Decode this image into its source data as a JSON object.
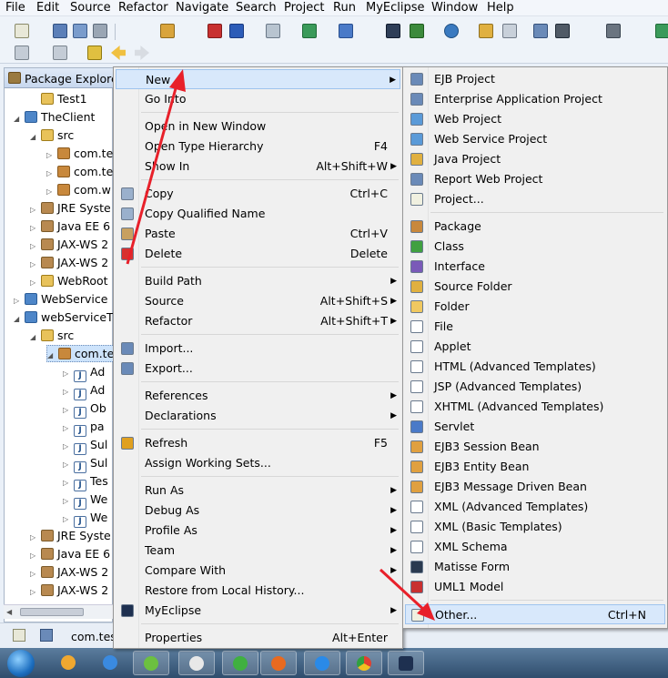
{
  "menubar": {
    "items": [
      "File",
      "Edit",
      "Source",
      "Refactor",
      "Navigate",
      "Search",
      "Project",
      "Run",
      "MyEclipse",
      "Window",
      "Help"
    ]
  },
  "explorer": {
    "title": "Package Explore",
    "tree": [
      {
        "label": "Test1",
        "icon": "folder-icon"
      },
      {
        "label": "TheClient",
        "icon": "project-icon"
      },
      {
        "label": "src",
        "icon": "source-folder-icon"
      },
      {
        "label": "com.te",
        "icon": "package-icon"
      },
      {
        "label": "com.te",
        "icon": "package-icon"
      },
      {
        "label": "com.w",
        "icon": "package-icon"
      },
      {
        "label": "JRE Syste",
        "icon": "library-icon"
      },
      {
        "label": "Java EE 6",
        "icon": "library-icon"
      },
      {
        "label": "JAX-WS 2",
        "icon": "library-icon"
      },
      {
        "label": "JAX-WS 2",
        "icon": "library-icon"
      },
      {
        "label": "WebRoot",
        "icon": "folder-icon"
      },
      {
        "label": "WebService",
        "icon": "project-icon"
      },
      {
        "label": "webServiceT",
        "icon": "project-icon"
      },
      {
        "label": "src",
        "icon": "source-folder-icon"
      },
      {
        "label": "com.te",
        "icon": "package-icon"
      },
      {
        "label": "Ad",
        "icon": "java-file-icon"
      },
      {
        "label": "Ad",
        "icon": "java-file-icon"
      },
      {
        "label": "Ob",
        "icon": "java-file-icon"
      },
      {
        "label": "pa",
        "icon": "java-file-icon"
      },
      {
        "label": "Sul",
        "icon": "java-file-icon"
      },
      {
        "label": "Sul",
        "icon": "java-file-icon"
      },
      {
        "label": "Tes",
        "icon": "java-file-icon"
      },
      {
        "label": "We",
        "icon": "java-file-icon"
      },
      {
        "label": "We",
        "icon": "java-file-icon"
      },
      {
        "label": "JRE Syste",
        "icon": "library-icon"
      },
      {
        "label": "Java EE 6",
        "icon": "library-icon"
      },
      {
        "label": "JAX-WS 2",
        "icon": "library-icon"
      },
      {
        "label": "JAX-WS 2",
        "icon": "library-icon"
      }
    ]
  },
  "status": {
    "text": "com.tes"
  },
  "context_menu": [
    {
      "label": "New",
      "arrow": true,
      "highlight": true
    },
    {
      "label": "Go Into"
    },
    {
      "sep": true
    },
    {
      "label": "Open in New Window"
    },
    {
      "label": "Open Type Hierarchy",
      "shortcut": "F4"
    },
    {
      "label": "Show In",
      "shortcut": "Alt+Shift+W",
      "arrow": true
    },
    {
      "sep": true
    },
    {
      "label": "Copy",
      "shortcut": "Ctrl+C",
      "icon": "copy-icon"
    },
    {
      "label": "Copy Qualified Name",
      "icon": "copy-qualified-icon"
    },
    {
      "label": "Paste",
      "shortcut": "Ctrl+V",
      "icon": "paste-icon"
    },
    {
      "label": "Delete",
      "shortcut": "Delete",
      "icon": "delete-icon"
    },
    {
      "sep": true
    },
    {
      "label": "Build Path",
      "arrow": true
    },
    {
      "label": "Source",
      "shortcut": "Alt+Shift+S",
      "arrow": true
    },
    {
      "label": "Refactor",
      "shortcut": "Alt+Shift+T",
      "arrow": true
    },
    {
      "sep": true
    },
    {
      "label": "Import...",
      "icon": "import-icon"
    },
    {
      "label": "Export...",
      "icon": "export-icon"
    },
    {
      "sep": true
    },
    {
      "label": "References",
      "arrow": true
    },
    {
      "label": "Declarations",
      "arrow": true
    },
    {
      "sep": true
    },
    {
      "label": "Refresh",
      "shortcut": "F5",
      "icon": "refresh-icon"
    },
    {
      "label": "Assign Working Sets..."
    },
    {
      "sep": true
    },
    {
      "label": "Run As",
      "arrow": true
    },
    {
      "label": "Debug As",
      "arrow": true
    },
    {
      "label": "Profile As",
      "arrow": true
    },
    {
      "label": "Team",
      "arrow": true
    },
    {
      "label": "Compare With",
      "arrow": true
    },
    {
      "label": "Restore from Local History..."
    },
    {
      "label": "MyEclipse",
      "arrow": true,
      "icon": "myeclipse-icon"
    },
    {
      "sep": true
    },
    {
      "label": "Properties",
      "shortcut": "Alt+Enter"
    }
  ],
  "submenu": [
    {
      "label": "EJB Project",
      "icon": "ejb-project-icon"
    },
    {
      "label": "Enterprise Application Project",
      "icon": "ear-project-icon"
    },
    {
      "label": "Web Project",
      "icon": "web-project-icon"
    },
    {
      "label": "Web Service Project",
      "icon": "web-service-project-icon"
    },
    {
      "label": "Java Project",
      "icon": "java-project-icon"
    },
    {
      "label": "Report Web Project",
      "icon": "report-project-icon"
    },
    {
      "label": "Project...",
      "icon": "project-wizard-icon"
    },
    {
      "sep": true
    },
    {
      "label": "Package",
      "icon": "package-icon"
    },
    {
      "label": "Class",
      "icon": "class-icon"
    },
    {
      "label": "Interface",
      "icon": "interface-icon"
    },
    {
      "label": "Source Folder",
      "icon": "source-folder-icon"
    },
    {
      "label": "Folder",
      "icon": "folder-icon"
    },
    {
      "label": "File",
      "icon": "file-icon"
    },
    {
      "label": "Applet",
      "icon": "applet-icon"
    },
    {
      "label": "HTML (Advanced Templates)",
      "icon": "html-icon"
    },
    {
      "label": "JSP (Advanced Templates)",
      "icon": "jsp-icon"
    },
    {
      "label": "XHTML (Advanced Templates)",
      "icon": "xhtml-icon"
    },
    {
      "label": "Servlet",
      "icon": "servlet-icon"
    },
    {
      "label": "EJB3 Session Bean",
      "icon": "session-bean-icon"
    },
    {
      "label": "EJB3 Entity Bean",
      "icon": "entity-bean-icon"
    },
    {
      "label": "EJB3 Message Driven Bean",
      "icon": "mdb-icon"
    },
    {
      "label": "XML (Advanced Templates)",
      "icon": "xml-icon"
    },
    {
      "label": "XML (Basic Templates)",
      "icon": "xml-basic-icon"
    },
    {
      "label": "XML Schema",
      "icon": "schema-icon"
    },
    {
      "label": "Matisse Form",
      "icon": "matisse-icon"
    },
    {
      "label": "UML1 Model",
      "icon": "uml-icon"
    },
    {
      "sep": true
    },
    {
      "label": "Other...",
      "shortcut": "Ctrl+N",
      "icon": "other-wizard-icon",
      "highlight": true
    }
  ],
  "colors": {
    "highlight": "#d8e8fb",
    "highlight_border": "#9ec3ee",
    "arrow": "#e8202a"
  }
}
